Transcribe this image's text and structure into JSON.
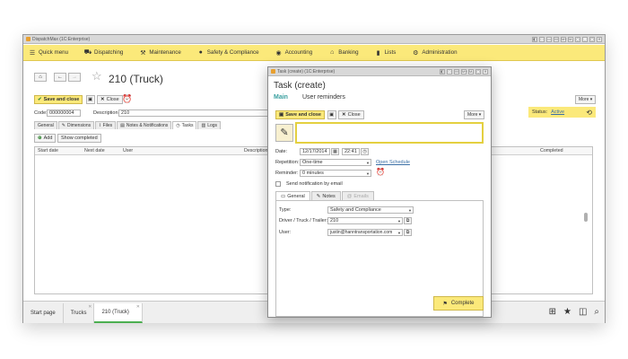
{
  "main_window": {
    "title": "DispatchMax (1C:Enterprise)",
    "controls": [
      "◧",
      "□",
      "▭",
      "M",
      "M+",
      "M-",
      "◻",
      "_",
      "▢",
      "✕"
    ]
  },
  "menu": [
    {
      "label": "Quick menu",
      "icon": "menu-icon",
      "glyph": "☰"
    },
    {
      "label": "Dispatching",
      "icon": "truck-icon",
      "glyph": "⛟"
    },
    {
      "label": "Maintenance",
      "icon": "wrench-icon",
      "glyph": "⚒"
    },
    {
      "label": "Safety & Compliance",
      "icon": "warning-icon",
      "glyph": "●"
    },
    {
      "label": "Accounting",
      "icon": "money-icon",
      "glyph": "◉"
    },
    {
      "label": "Banking",
      "icon": "bank-icon",
      "glyph": "⌂"
    },
    {
      "label": "Lists",
      "icon": "list-icon",
      "glyph": "▮"
    },
    {
      "label": "Administration",
      "icon": "gear-icon",
      "glyph": "⚙"
    }
  ],
  "form": {
    "title": "210 (Truck)",
    "save_close": "Save and close",
    "close": "Close",
    "code_label": "Code:",
    "code_value": "000000004",
    "desc_label": "Description:",
    "desc_value": "210",
    "more": "More ▾",
    "status_label": "Status:",
    "status_value": "Active",
    "tabs": [
      "General",
      "Dimensions",
      "Files",
      "Notes & Notifications",
      "Tasks",
      "Logs"
    ],
    "add_btn": "Add",
    "show_completed_btn": "Show completed",
    "grid_headers": [
      "Start date",
      "Next date",
      "User",
      "Description",
      "Completed"
    ]
  },
  "dialog": {
    "window_title": "Task (create) (1C:Enterprise)",
    "title": "Task (create)",
    "tab_main": "Main",
    "tab_reminders": "User reminders",
    "save_close": "Save and close",
    "close": "Close",
    "more": "More ▾",
    "date_label": "Date:",
    "date_value": "12/17/2014",
    "time_value": "22:41",
    "repetition_label": "Repetition:",
    "repetition_value": "One-time",
    "open_schedule": "Open Schedule",
    "reminder_label": "Reminder:",
    "reminder_value": "0 minutes",
    "send_email_label": "Send notification by email",
    "sub_tabs": [
      "General",
      "Notes",
      "Emails"
    ],
    "type_label": "Type:",
    "type_value": "Safety and Compliance",
    "driver_label": "Driver / Truck / Trailer:",
    "driver_value": "210",
    "user_label": "User:",
    "user_value": "justin@hanntransportation.com",
    "complete_btn": "Complete"
  },
  "taskbar": {
    "tabs": [
      "Start page",
      "Trucks",
      "210 (Truck)"
    ],
    "active": "210 (Truck)"
  },
  "colors": {
    "accent_yellow": "#fbe97a",
    "link_blue": "#3a6ea5",
    "teal": "#3aa0a0",
    "active_tab_green": "#4caf50"
  }
}
